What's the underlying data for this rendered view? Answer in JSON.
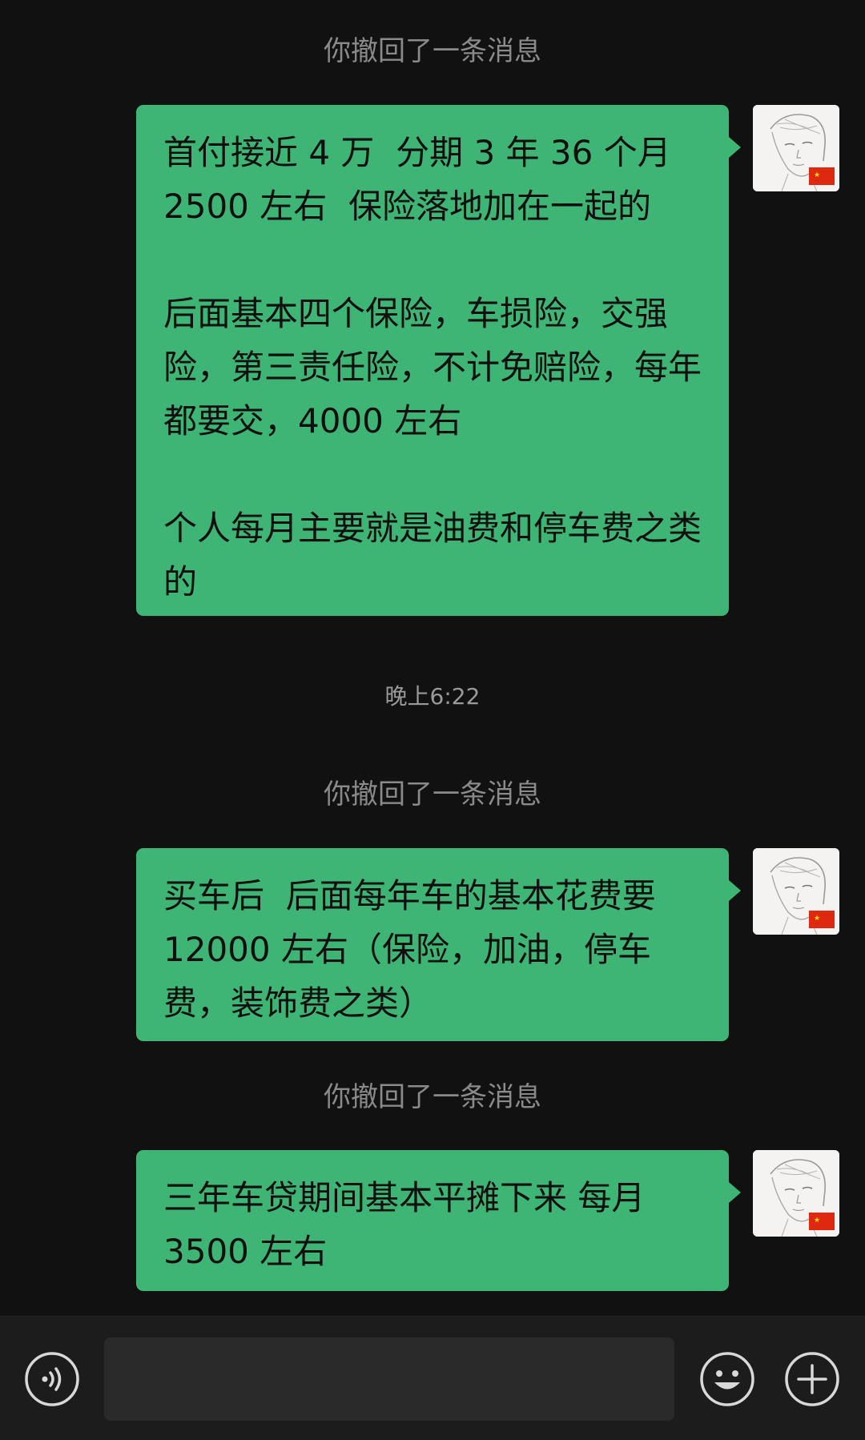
{
  "chat": {
    "system_note_1": "你撤回了一条消息",
    "message_1": "首付接近 4 万  分期 3 年 36 个月 2500 左右  保险落地加在一起的\n\n后面基本四个保险，车损险，交强险，第三责任险，不计免赔险，每年都要交，4000 左右\n\n个人每月主要就是油费和停车费之类的",
    "timestamp_1": "晚上6:22",
    "system_note_2": "你撤回了一条消息",
    "message_2": "买车后  后面每年车的基本花费要12000 左右（保险，加油，停车费，装饰费之类）",
    "system_note_3": "你撤回了一条消息",
    "message_3": "三年车贷期间基本平摊下来 每月3500 左右"
  },
  "input_bar": {
    "voice_icon": "voice-icon",
    "emoji_icon": "emoji-icon",
    "plus_icon": "plus-icon",
    "text_value": ""
  },
  "colors": {
    "background": "#111111",
    "bubble": "#3eb575",
    "system_text": "#8a8a8a",
    "input_bar": "#1c1c1c"
  }
}
